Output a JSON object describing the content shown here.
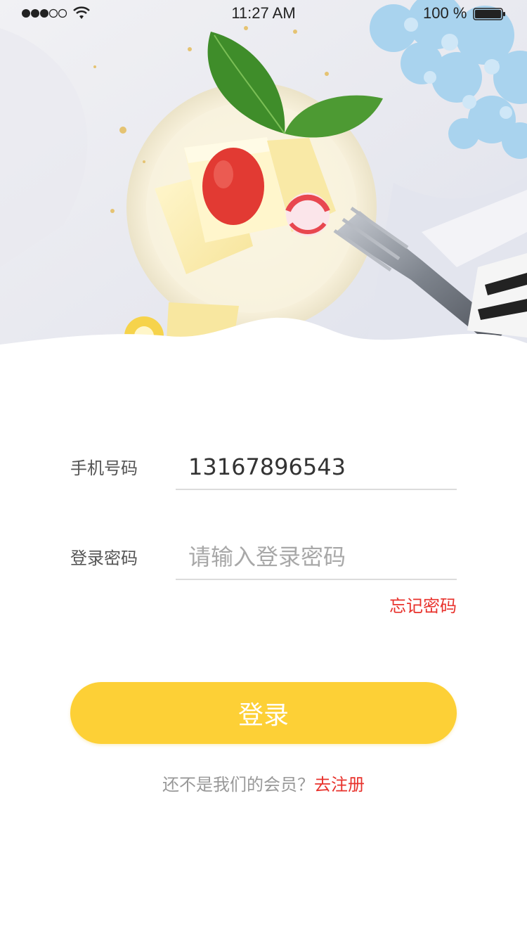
{
  "status_bar": {
    "time": "11:27 AM",
    "battery_percent": "100 %",
    "battery_level": 1.0,
    "signal_bars_filled": 3,
    "signal_bars_total": 5
  },
  "hero": {
    "image_description_icon": "dessert-photo"
  },
  "form": {
    "phone": {
      "label": "手机号码",
      "value": "13167896543",
      "placeholder": ""
    },
    "password": {
      "label": "登录密码",
      "value": "",
      "placeholder": "请输入登录密码"
    },
    "forgot_label": "忘记密码"
  },
  "login_button": {
    "label": "登录"
  },
  "register": {
    "prompt": "还不是我们的会员？",
    "link_label": "去注册"
  },
  "colors": {
    "accent_yellow": "#fdd036",
    "link_red": "#e8322c",
    "divider": "#dcdcdc"
  }
}
